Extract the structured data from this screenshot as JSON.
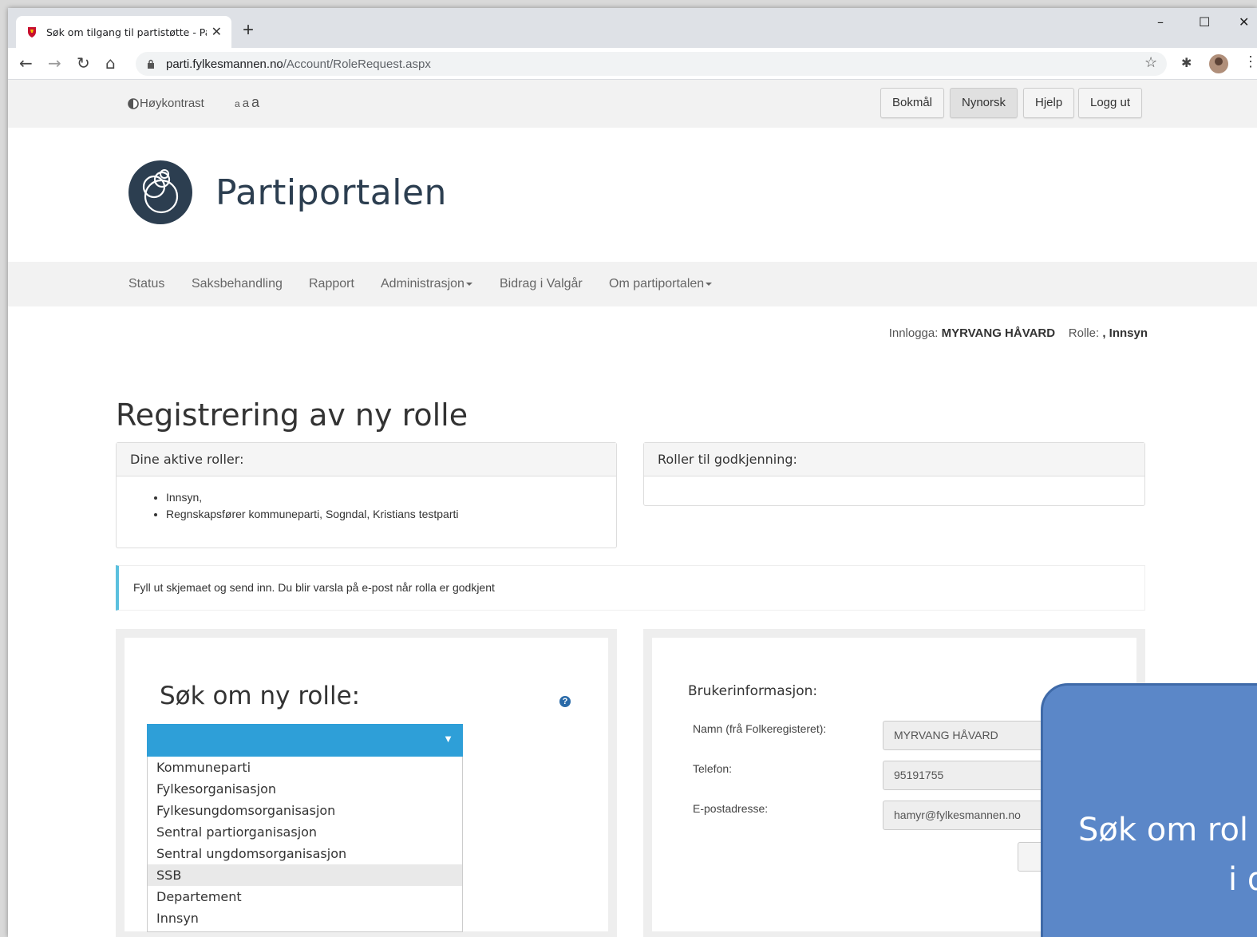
{
  "browser": {
    "tab_title": "Søk om tilgang til partistøtte - Pa",
    "tab_close": "✕",
    "new_tab": "+",
    "url_host": "parti.fylkesmannen.no",
    "url_path": "/Account/RoleRequest.aspx",
    "window_controls": {
      "minimize": "–",
      "maximize": "☐",
      "close": "✕"
    }
  },
  "topbar": {
    "high_contrast": "Høykontrast",
    "font_sizes": [
      "a",
      "a",
      "a"
    ],
    "buttons": {
      "bokmal": "Bokmål",
      "nynorsk": "Nynorsk",
      "help": "Hjelp",
      "logout": "Logg ut"
    }
  },
  "brand": {
    "title": "Partiportalen",
    "logo_color": "#2c3e50"
  },
  "nav": {
    "items": [
      "Status",
      "Saksbehandling",
      "Rapport",
      "Administrasjon",
      "Bidrag i Valgår",
      "Om partiportalen"
    ]
  },
  "login": {
    "prefix": "Innlogga:",
    "user": "MYRVANG HÅVARD",
    "role_label": "Rolle:",
    "role": ", Innsyn"
  },
  "page": {
    "title": "Registrering av ny rolle"
  },
  "active_roles": {
    "heading": "Dine aktive roller:",
    "items": [
      "Innsyn,",
      "Regnskapsfører kommuneparti, Sogndal, Kristians testparti"
    ]
  },
  "pending_roles": {
    "heading": "Roller til godkjenning:"
  },
  "alert": {
    "text": "Fyll ut skjemaet og send inn. Du blir varsla på e-post når rolla er godkjent",
    "accent": "#5bc0de"
  },
  "request": {
    "title": "Søk om ny rolle:",
    "help": "?",
    "select_arrow": "▼",
    "select_color": "#2e9fd8",
    "options": [
      "Kommuneparti",
      "Fylkesorganisasjon",
      "Fylkesungdomsorganisasjon",
      "Sentral partiorganisasjon",
      "Sentral ungdomsorganisasjon",
      "SSB",
      "Departement",
      "Innsyn"
    ],
    "highlighted": "SSB"
  },
  "userinfo": {
    "title": "Brukerinformasjon:",
    "name_label": "Namn (frå Folkeregisteret):",
    "name_value": "MYRVANG HÅVARD",
    "phone_label": "Telefon:",
    "phone_value": "95191755",
    "email_label": "E-postadresse:",
    "email_value": "hamyr@fylkesmannen.no"
  },
  "callout": {
    "line1": "Søk om rol",
    "line2": "i d",
    "color": "#5b87c8"
  }
}
